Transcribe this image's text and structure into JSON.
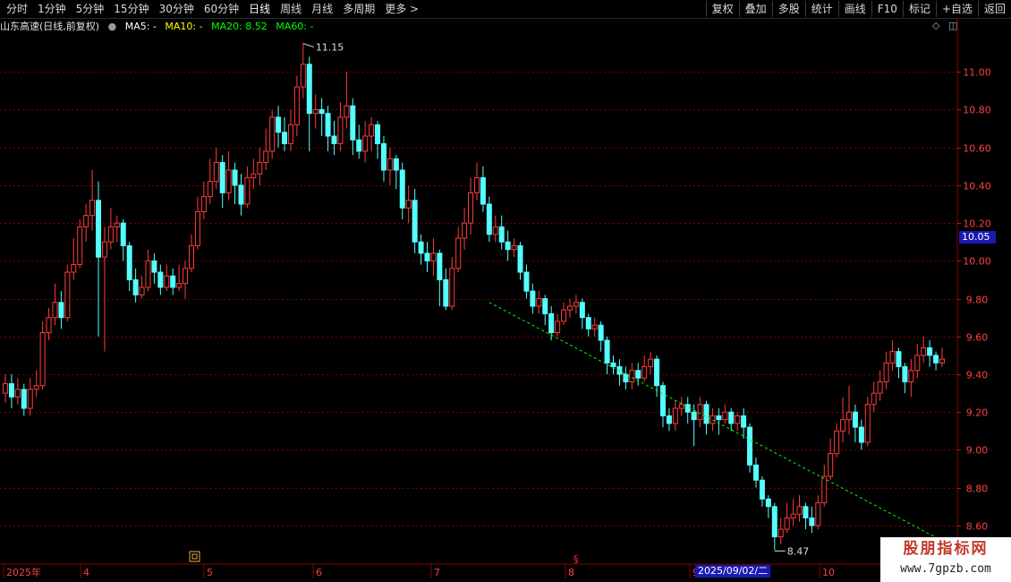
{
  "toolbar": {
    "periods": [
      "分时",
      "1分钟",
      "5分钟",
      "15分钟",
      "30分钟",
      "60分钟",
      "日线",
      "周线",
      "月线",
      "多周期",
      "更多 >"
    ],
    "active_period": "日线",
    "buttons": [
      "复权",
      "叠加",
      "多股",
      "统计",
      "画线",
      "F10",
      "标记",
      "+自选",
      "返回"
    ]
  },
  "legend": {
    "stock": "山东高速(日线,前复权)",
    "ma5": "MA5: -",
    "ma10": "MA10: -",
    "ma20": "MA20: 8.52",
    "ma60": "MA60: -"
  },
  "colors": {
    "up": "#ff3b3b",
    "down": "#54ffff",
    "grid": "#7a0000",
    "trend": "#00ff00",
    "ma5": "#ffffff",
    "ma10": "#ffff00",
    "ma20": "#00ff00",
    "ma60": "#00ff00"
  },
  "crosshair": {
    "date": "2025/09/02/二",
    "price": "10.05"
  },
  "watermark": {
    "title": "股朋指标网",
    "url": "www.7gpzb.com"
  },
  "chart_data": {
    "type": "candlestick",
    "ylim": [
      8.5,
      11.2
    ],
    "yticks": [
      8.6,
      8.8,
      9.0,
      9.2,
      9.4,
      9.6,
      9.8,
      10.0,
      10.2,
      10.4,
      10.6,
      10.8,
      11.0
    ],
    "xticks": [
      "2025年",
      "4",
      "5",
      "6",
      "7",
      "8",
      "9",
      "10"
    ],
    "annotations": [
      {
        "label": "11.15",
        "type": "high"
      },
      {
        "label": "8.47",
        "type": "low"
      }
    ],
    "trendline": {
      "start": 9.78,
      "end": 8.52
    },
    "candles": [
      [
        9.3,
        9.35,
        9.4,
        9.25
      ],
      [
        9.35,
        9.28,
        9.4,
        9.22
      ],
      [
        9.28,
        9.32,
        9.38,
        9.24
      ],
      [
        9.32,
        9.22,
        9.35,
        9.18
      ],
      [
        9.22,
        9.32,
        9.38,
        9.18
      ],
      [
        9.32,
        9.34,
        9.42,
        9.28
      ],
      [
        9.34,
        9.62,
        9.68,
        9.32
      ],
      [
        9.62,
        9.7,
        9.75,
        9.58
      ],
      [
        9.7,
        9.78,
        9.88,
        9.66
      ],
      [
        9.78,
        9.7,
        9.84,
        9.64
      ],
      [
        9.7,
        9.94,
        9.98,
        9.68
      ],
      [
        9.94,
        9.98,
        10.12,
        9.9
      ],
      [
        9.98,
        10.18,
        10.22,
        9.96
      ],
      [
        10.18,
        10.24,
        10.3,
        10.1
      ],
      [
        10.24,
        10.32,
        10.48,
        10.16
      ],
      [
        10.32,
        10.02,
        10.42,
        9.6
      ],
      [
        10.02,
        10.1,
        10.18,
        9.52
      ],
      [
        10.1,
        10.18,
        10.28,
        10.06
      ],
      [
        10.18,
        10.2,
        10.24,
        10.1
      ],
      [
        10.2,
        10.08,
        10.22,
        10.0
      ],
      [
        10.08,
        9.9,
        10.1,
        9.84
      ],
      [
        9.9,
        9.82,
        9.96,
        9.78
      ],
      [
        9.82,
        9.86,
        9.92,
        9.8
      ],
      [
        9.86,
        10.0,
        10.06,
        9.84
      ],
      [
        10.0,
        9.94,
        10.04,
        9.88
      ],
      [
        9.94,
        9.86,
        9.98,
        9.82
      ],
      [
        9.86,
        9.92,
        9.98,
        9.84
      ],
      [
        9.92,
        9.86,
        9.96,
        9.82
      ],
      [
        9.86,
        9.88,
        9.98,
        9.84
      ],
      [
        9.88,
        9.96,
        10.0,
        9.8
      ],
      [
        9.96,
        10.08,
        10.14,
        9.94
      ],
      [
        10.08,
        10.26,
        10.34,
        10.06
      ],
      [
        10.26,
        10.34,
        10.42,
        10.22
      ],
      [
        10.34,
        10.42,
        10.54,
        10.3
      ],
      [
        10.42,
        10.52,
        10.6,
        10.38
      ],
      [
        10.52,
        10.36,
        10.56,
        10.28
      ],
      [
        10.36,
        10.48,
        10.58,
        10.32
      ],
      [
        10.48,
        10.4,
        10.52,
        10.3
      ],
      [
        10.4,
        10.3,
        10.46,
        10.24
      ],
      [
        10.3,
        10.44,
        10.5,
        10.28
      ],
      [
        10.44,
        10.46,
        10.54,
        10.38
      ],
      [
        10.46,
        10.52,
        10.6,
        10.4
      ],
      [
        10.52,
        10.58,
        10.7,
        10.48
      ],
      [
        10.58,
        10.76,
        10.8,
        10.54
      ],
      [
        10.76,
        10.68,
        10.82,
        10.6
      ],
      [
        10.68,
        10.62,
        10.76,
        10.58
      ],
      [
        10.62,
        10.72,
        10.8,
        10.58
      ],
      [
        10.72,
        10.92,
        10.98,
        10.66
      ],
      [
        10.92,
        11.04,
        11.15,
        10.86
      ],
      [
        11.04,
        10.78,
        11.08,
        10.58
      ],
      [
        10.78,
        10.8,
        10.88,
        10.7
      ],
      [
        10.8,
        10.78,
        10.86,
        10.66
      ],
      [
        10.78,
        10.66,
        10.82,
        10.58
      ],
      [
        10.66,
        10.62,
        10.74,
        10.56
      ],
      [
        10.62,
        10.76,
        10.84,
        10.58
      ],
      [
        10.76,
        10.82,
        11.0,
        10.7
      ],
      [
        10.82,
        10.64,
        10.86,
        10.56
      ],
      [
        10.64,
        10.58,
        10.72,
        10.54
      ],
      [
        10.58,
        10.66,
        10.74,
        10.52
      ],
      [
        10.66,
        10.72,
        10.76,
        10.58
      ],
      [
        10.72,
        10.62,
        10.74,
        10.54
      ],
      [
        10.62,
        10.48,
        10.66,
        10.42
      ],
      [
        10.48,
        10.54,
        10.6,
        10.4
      ],
      [
        10.54,
        10.48,
        10.56,
        10.38
      ],
      [
        10.48,
        10.28,
        10.52,
        10.22
      ],
      [
        10.28,
        10.32,
        10.4,
        10.2
      ],
      [
        10.32,
        10.1,
        10.38,
        10.04
      ],
      [
        10.1,
        10.04,
        10.14,
        9.98
      ],
      [
        10.04,
        10.0,
        10.1,
        9.94
      ],
      [
        10.0,
        10.04,
        10.12,
        9.92
      ],
      [
        10.04,
        9.9,
        10.06,
        9.76
      ],
      [
        9.9,
        9.76,
        9.96,
        9.74
      ],
      [
        9.76,
        9.96,
        10.02,
        9.74
      ],
      [
        9.96,
        10.12,
        10.18,
        9.94
      ],
      [
        10.12,
        10.2,
        10.28,
        10.06
      ],
      [
        10.2,
        10.36,
        10.44,
        10.14
      ],
      [
        10.36,
        10.44,
        10.52,
        10.32
      ],
      [
        10.44,
        10.3,
        10.5,
        10.26
      ],
      [
        10.3,
        10.14,
        10.34,
        10.1
      ],
      [
        10.14,
        10.18,
        10.24,
        10.1
      ],
      [
        10.18,
        10.1,
        10.24,
        10.06
      ],
      [
        10.1,
        10.06,
        10.16,
        10.0
      ],
      [
        10.06,
        10.08,
        10.12,
        10.02
      ],
      [
        10.08,
        9.94,
        10.1,
        9.9
      ],
      [
        9.94,
        9.84,
        9.98,
        9.8
      ],
      [
        9.84,
        9.76,
        9.88,
        9.72
      ],
      [
        9.76,
        9.8,
        9.84,
        9.72
      ],
      [
        9.8,
        9.72,
        9.82,
        9.66
      ],
      [
        9.72,
        9.62,
        9.76,
        9.58
      ],
      [
        9.62,
        9.68,
        9.72,
        9.6
      ],
      [
        9.68,
        9.74,
        9.78,
        9.66
      ],
      [
        9.74,
        9.76,
        9.8,
        9.7
      ],
      [
        9.76,
        9.78,
        9.82,
        9.72
      ],
      [
        9.78,
        9.7,
        9.8,
        9.64
      ],
      [
        9.7,
        9.64,
        9.72,
        9.6
      ],
      [
        9.64,
        9.66,
        9.7,
        9.6
      ],
      [
        9.66,
        9.58,
        9.68,
        9.52
      ],
      [
        9.58,
        9.46,
        9.6,
        9.4
      ],
      [
        9.46,
        9.44,
        9.5,
        9.4
      ],
      [
        9.44,
        9.4,
        9.48,
        9.34
      ],
      [
        9.4,
        9.36,
        9.44,
        9.32
      ],
      [
        9.36,
        9.42,
        9.46,
        9.32
      ],
      [
        9.42,
        9.38,
        9.46,
        9.34
      ],
      [
        9.38,
        9.44,
        9.5,
        9.36
      ],
      [
        9.44,
        9.48,
        9.52,
        9.4
      ],
      [
        9.48,
        9.34,
        9.5,
        9.28
      ],
      [
        9.34,
        9.18,
        9.36,
        9.12
      ],
      [
        9.18,
        9.14,
        9.22,
        9.1
      ],
      [
        9.14,
        9.22,
        9.26,
        9.1
      ],
      [
        9.22,
        9.24,
        9.28,
        9.18
      ],
      [
        9.24,
        9.2,
        9.28,
        9.14
      ],
      [
        9.2,
        9.16,
        9.24,
        9.02
      ],
      [
        9.16,
        9.24,
        9.28,
        9.12
      ],
      [
        9.24,
        9.14,
        9.26,
        9.08
      ],
      [
        9.14,
        9.18,
        9.22,
        9.1
      ],
      [
        9.18,
        9.16,
        9.22,
        9.08
      ],
      [
        9.16,
        9.2,
        9.24,
        9.14
      ],
      [
        9.2,
        9.14,
        9.22,
        9.1
      ],
      [
        9.14,
        9.18,
        9.2,
        9.1
      ],
      [
        9.18,
        9.12,
        9.22,
        9.06
      ],
      [
        9.12,
        8.92,
        9.14,
        8.88
      ],
      [
        8.92,
        8.84,
        8.96,
        8.8
      ],
      [
        8.84,
        8.74,
        8.86,
        8.7
      ],
      [
        8.74,
        8.7,
        8.76,
        8.64
      ],
      [
        8.7,
        8.54,
        8.72,
        8.47
      ],
      [
        8.54,
        8.58,
        8.64,
        8.5
      ],
      [
        8.58,
        8.64,
        8.72,
        8.56
      ],
      [
        8.64,
        8.66,
        8.74,
        8.6
      ],
      [
        8.66,
        8.7,
        8.76,
        8.62
      ],
      [
        8.7,
        8.64,
        8.72,
        8.58
      ],
      [
        8.64,
        8.6,
        8.7,
        8.56
      ],
      [
        8.6,
        8.72,
        8.76,
        8.58
      ],
      [
        8.72,
        8.86,
        8.92,
        8.7
      ],
      [
        8.86,
        8.98,
        9.06,
        8.84
      ],
      [
        8.98,
        9.1,
        9.14,
        8.96
      ],
      [
        9.1,
        9.16,
        9.28,
        9.04
      ],
      [
        9.16,
        9.2,
        9.34,
        9.08
      ],
      [
        9.2,
        9.12,
        9.24,
        9.04
      ],
      [
        9.12,
        9.04,
        9.16,
        9.0
      ],
      [
        9.04,
        9.24,
        9.28,
        9.02
      ],
      [
        9.24,
        9.3,
        9.36,
        9.2
      ],
      [
        9.3,
        9.36,
        9.42,
        9.26
      ],
      [
        9.36,
        9.46,
        9.52,
        9.32
      ],
      [
        9.46,
        9.52,
        9.58,
        9.42
      ],
      [
        9.52,
        9.44,
        9.54,
        9.38
      ],
      [
        9.44,
        9.36,
        9.46,
        9.3
      ],
      [
        9.36,
        9.42,
        9.48,
        9.28
      ],
      [
        9.42,
        9.5,
        9.56,
        9.38
      ],
      [
        9.5,
        9.54,
        9.6,
        9.46
      ],
      [
        9.54,
        9.5,
        9.58,
        9.44
      ],
      [
        9.5,
        9.46,
        9.52,
        9.42
      ],
      [
        9.46,
        9.48,
        9.54,
        9.44
      ]
    ]
  }
}
